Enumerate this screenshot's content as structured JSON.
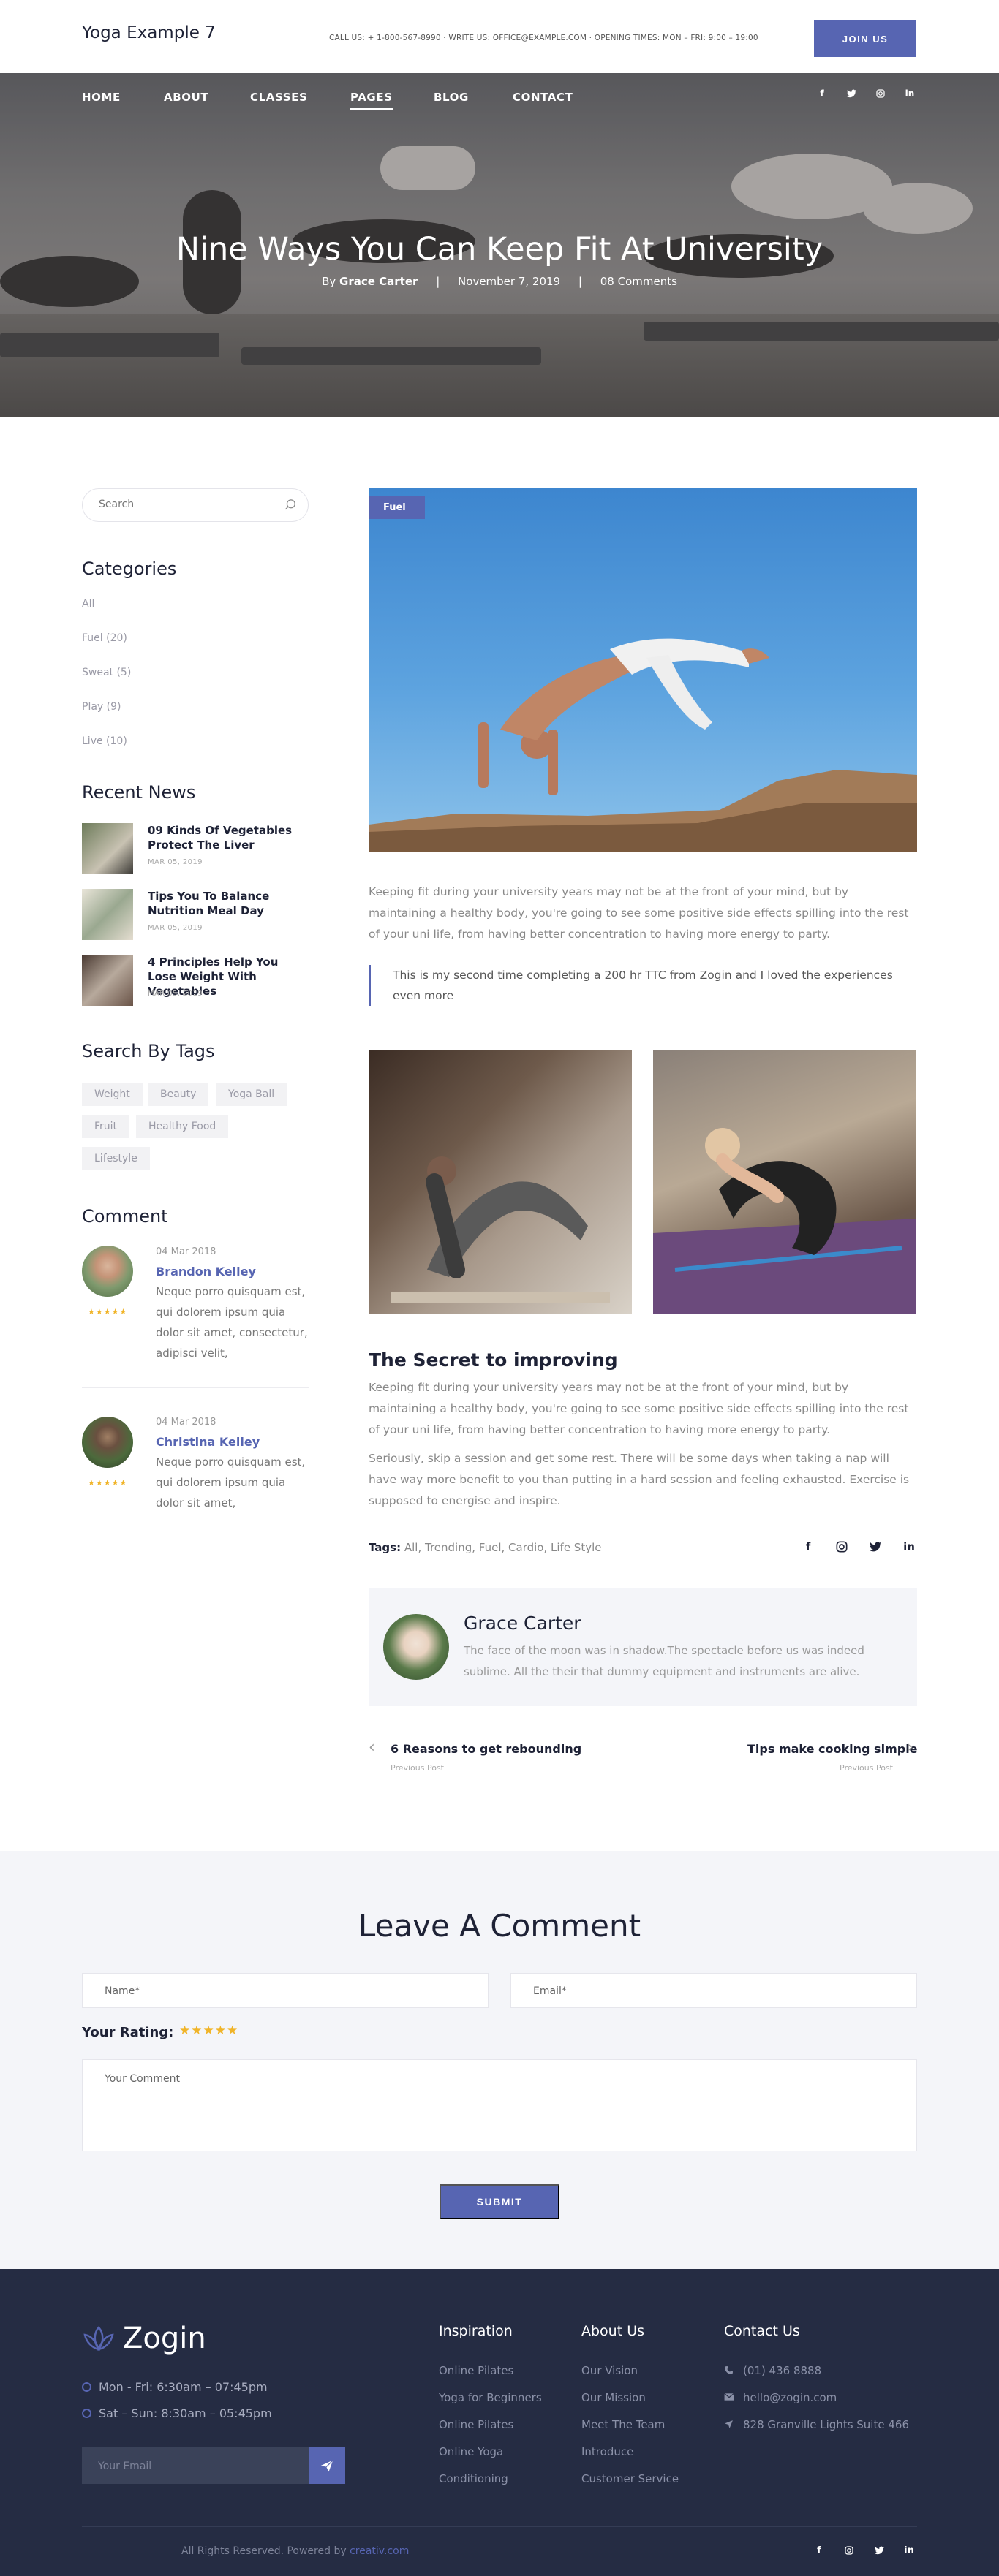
{
  "header": {
    "brand": "Yoga Example 7",
    "contact": "CALL US: + 1-800-567-8990 · WRITE US: OFFICE@EXAMPLE.COM · OPENING TIMES: MON – FRI: 9:00 – 19:00",
    "join_label": "JOIN US"
  },
  "nav": {
    "items": [
      "HOME",
      "ABOUT",
      "CLASSES",
      "PAGES",
      "BLOG",
      "CONTACT"
    ],
    "active": "PAGES",
    "social": [
      "f",
      "t",
      "ig",
      "in"
    ]
  },
  "hero": {
    "title": "Nine Ways You Can Keep Fit At University",
    "by": "By",
    "author": "Grace Carter",
    "divider": "|",
    "date": "November 7, 2019",
    "comments": "08 Comments"
  },
  "sidebar": {
    "search_placeholder": "Search",
    "categories_title": "Categories",
    "categories": [
      "All",
      "Fuel (20)",
      "Sweat (5)",
      "Play (9)",
      "Live (10)"
    ],
    "news_title": "Recent News",
    "news": [
      {
        "title": "09 Kinds Of Vegetables Protect The Liver",
        "date": "MAR 05, 2019"
      },
      {
        "title": "Tips You To Balance Nutrition Meal Day",
        "date": "MAR 05, 2019"
      },
      {
        "title": "4 Principles Help You Lose Weight With Vegetables",
        "date": "MAR 05, 2019"
      }
    ],
    "tags_title": "Search By Tags",
    "tags": [
      "Weight",
      "Beauty",
      "Yoga Ball",
      "Fruit",
      "Healthy Food",
      "Lifestyle"
    ],
    "comment_title": "Comment",
    "comments": [
      {
        "date": "04 Mar 2018",
        "name": "Brandon Kelley",
        "rating": "★★★★★",
        "text": "Neque porro quisquam est, qui dolorem ipsum quia dolor sit amet, consectetur, adipisci velit,"
      },
      {
        "date": "04 Mar 2018",
        "name": "Christina Kelley",
        "rating": "★★★★★",
        "text": "Neque porro quisquam est, qui dolorem ipsum quia dolor sit amet,"
      }
    ]
  },
  "article": {
    "badge": "Fuel",
    "intro": "Keeping fit during your university years may not be at the front of your mind, but by maintaining a healthy body, you're going to see some positive side effects spilling into the rest of your uni life, from having better concentration to having more energy to party.",
    "quote": "This is my second time completing a 200 hr TTC from Zogin and I loved the experiences even more",
    "subtitle": "The Secret to improving",
    "para1": "Keeping fit during your university years may not be at the front of your mind, but by maintaining a healthy body, you're going to see some positive side effects spilling into the rest of your uni life, from having better concentration to having more energy to party.",
    "para2": "Seriously, skip a session and get some rest. There will be some days when taking a nap will have way more benefit to you than putting in a hard session and feeling exhausted. Exercise is supposed to energise and inspire.",
    "tags_label": "Tags:",
    "tags_value": "All, Trending, Fuel, Cardio, Life Style",
    "share": [
      "f",
      "ig",
      "t",
      "in"
    ]
  },
  "author_box": {
    "name": "Grace Carter",
    "bio": "The face of the moon was in shadow.The spectacle before us was indeed sublime. All the their that dummy equipment and instruments are alive."
  },
  "post_nav": {
    "prev_title": "6 Reasons to get rebounding",
    "prev_label": "Previous Post",
    "next_title": "Tips make cooking simple",
    "next_label": "Previous Post",
    "prev_chev": "‹",
    "next_chev": "›"
  },
  "comment_form": {
    "title": "Leave A Comment",
    "name_placeholder": "Name*",
    "email_placeholder": "Email*",
    "rating_label": "Your Rating:",
    "rating_stars": "★★★★★",
    "comment_placeholder": "Your Comment",
    "submit_label": "SUBMIT"
  },
  "footer": {
    "logo": "Zogin",
    "hours": [
      "Mon - Fri: 6:30am – 07:45pm",
      "Sat – Sun: 8:30am – 05:45pm"
    ],
    "email_placeholder": "Your Email",
    "col1_title": "Inspiration",
    "col1": [
      "Online Pilates",
      "Yoga for Beginners",
      "Online Pilates",
      "Online Yoga",
      "Conditioning"
    ],
    "col2_title": "About Us",
    "col2": [
      "Our Vision",
      "Our Mission",
      "Meet The Team",
      "Introduce",
      "Customer Service"
    ],
    "col3_title": "Contact Us",
    "col3": [
      "(01) 436 8888",
      "hello@zogin.com",
      "828 Granville Lights Suite 466"
    ],
    "copyright_text": "All Rights Reserved. Powered by",
    "copyright_link": "creativ.com",
    "social": [
      "f",
      "ig",
      "t",
      "in"
    ]
  },
  "colors": {
    "accent": "#5765b2",
    "dark": "#1e2236",
    "footer_bg": "#252c43",
    "star": "#f0b429"
  }
}
